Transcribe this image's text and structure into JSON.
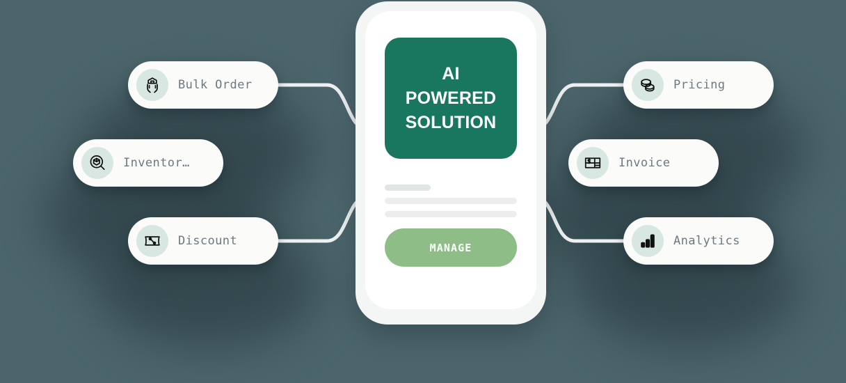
{
  "theme": {
    "background": "#4c656c",
    "hero_green": "#1a775f",
    "button_green": "#8fbd88",
    "card_background": "#fbfbfa",
    "icon_circle": "#d8e7e1",
    "label_color": "#6c7a7e",
    "connector_color": "#eef1f1"
  },
  "phone": {
    "hero": {
      "line1": "AI",
      "line2": "POWERED",
      "line3": "SOLUTION"
    },
    "skeleton_lines": 3,
    "manage_button": {
      "label": "MANAGE"
    }
  },
  "left_cards": [
    {
      "id": "bulk-order",
      "label": "Bulk Order",
      "icon": "hands-holding-warehouse-icon"
    },
    {
      "id": "inventory",
      "label": "Inventor…",
      "icon": "cube-magnifier-icon"
    },
    {
      "id": "discount",
      "label": "Discount",
      "icon": "percent-coupon-icon"
    }
  ],
  "right_cards": [
    {
      "id": "pricing",
      "label": "Pricing",
      "icon": "stacked-coins-icon"
    },
    {
      "id": "invoice",
      "label": "Invoice",
      "icon": "dollar-receipt-icon"
    },
    {
      "id": "analytics",
      "label": "Analytics",
      "icon": "bar-chart-icon"
    }
  ]
}
